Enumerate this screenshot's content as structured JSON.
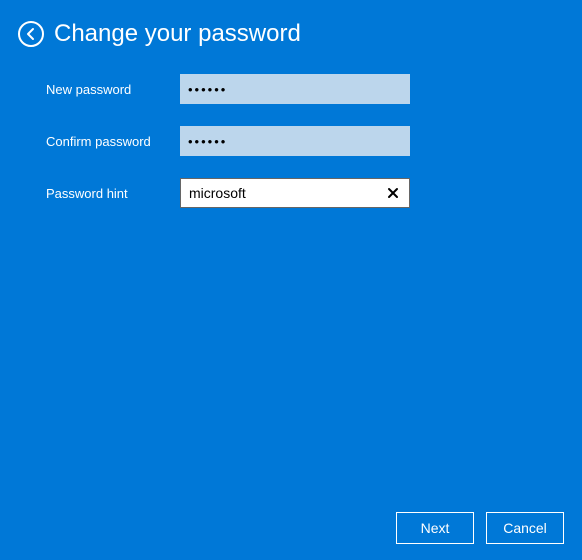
{
  "title": "Change your password",
  "fields": {
    "new_password": {
      "label": "New password",
      "value": "••••••"
    },
    "confirm_password": {
      "label": "Confirm password",
      "value": "••••••"
    },
    "hint": {
      "label": "Password hint",
      "value": "microsoft"
    }
  },
  "buttons": {
    "next": "Next",
    "cancel": "Cancel"
  }
}
